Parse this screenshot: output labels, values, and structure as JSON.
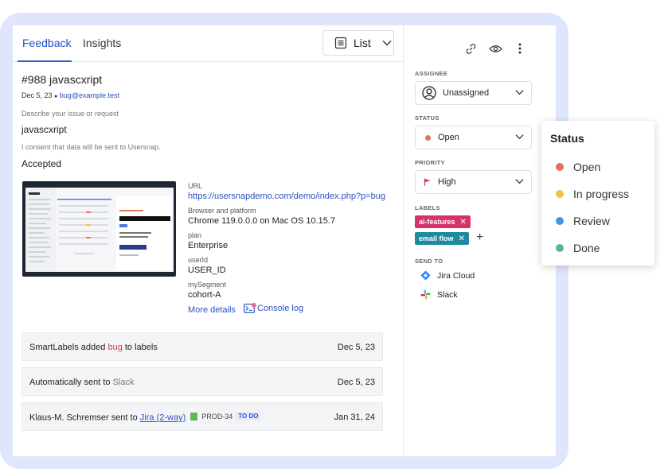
{
  "tabs": [
    {
      "label": "Feedback",
      "active": true
    },
    {
      "label": "Insights",
      "active": false
    }
  ],
  "view_select": {
    "label": "List"
  },
  "feedback": {
    "title": "#988 javascxript",
    "date": "Dec 5, 23",
    "separator": "●",
    "email": "bug@example.test",
    "question_label": "Describe your issue or request",
    "question_value": "javascxript",
    "consent_label": "I consent that data will be sent to Usersnap.",
    "consent_value": "Accepted"
  },
  "fields": [
    {
      "label": "URL",
      "value": "https://usersnapdemo.com/demo/index.php?p=bug",
      "is_link": true
    },
    {
      "label": "Browser and platform",
      "value": "Chrome 119.0.0.0 on Mac OS 10.15.7"
    },
    {
      "label": "plan",
      "value": "Enterprise"
    },
    {
      "label": "userId",
      "value": "USER_ID"
    },
    {
      "label": "mySegment",
      "value": "cohort-A"
    }
  ],
  "links": {
    "more_details": "More details",
    "console_log": "Console log"
  },
  "activity": [
    {
      "pre": "SmartLabels added ",
      "highlight": "bug",
      "post": " to labels",
      "date": "Dec 5, 23"
    },
    {
      "pre": "Automatically sent to ",
      "highlight": "Slack",
      "post": "",
      "date": "Dec 5, 23"
    },
    {
      "pre": "Klaus-M. Schremser sent to ",
      "highlight": "Jira (2-way)",
      "post": "",
      "ticket": "PROD-34",
      "ticket_status": "TO DO",
      "date": "Jan 31, 24"
    }
  ],
  "sidebar": {
    "assignee_label": "ASSIGNEE",
    "assignee_value": "Unassigned",
    "status_label": "STATUS",
    "status_value": "Open",
    "priority_label": "PRIORITY",
    "priority_value": "High",
    "labels_label": "LABELS",
    "labels": [
      {
        "text": "ai-features",
        "color": "#d6336c"
      },
      {
        "text": "email flow",
        "color": "#1f8a9e"
      }
    ],
    "send_to_label": "SEND TO",
    "send_to": [
      {
        "name": "Jira Cloud",
        "icon": "jira-icon"
      },
      {
        "name": "Slack",
        "icon": "slack-icon"
      }
    ]
  },
  "status_popover": {
    "title": "Status",
    "options": [
      {
        "label": "Open",
        "color": "#e0735a"
      },
      {
        "label": "In progress",
        "color": "#f2c049"
      },
      {
        "label": "Review",
        "color": "#3d97e8"
      },
      {
        "label": "Done",
        "color": "#54b98f"
      }
    ]
  },
  "colors": {
    "accent": "#2f5fd6",
    "frame": "#dfe6fb"
  }
}
